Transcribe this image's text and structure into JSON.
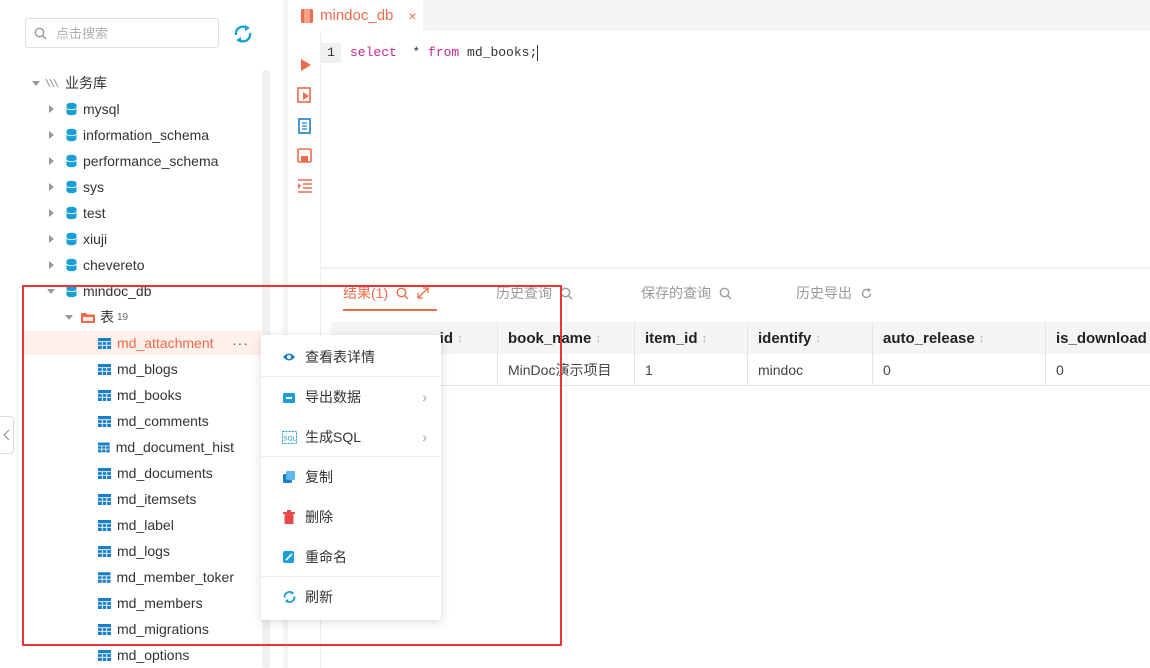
{
  "sidebar": {
    "search_placeholder": "点击搜索",
    "root": "业务库",
    "databases": [
      "mysql",
      "information_schema",
      "performance_schema",
      "sys",
      "test",
      "xiuji",
      "chevereto"
    ],
    "open_db": "mindoc_db",
    "tables_folder": "表",
    "tables_count": "19",
    "tables": [
      "md_attachment",
      "md_blogs",
      "md_books",
      "md_comments",
      "md_document_hist",
      "md_documents",
      "md_itemsets",
      "md_label",
      "md_logs",
      "md_member_toker",
      "md_members",
      "md_migrations",
      "md_options"
    ],
    "more_glyph": "···"
  },
  "editor": {
    "tab_title": "mindoc_db",
    "tab_close": "×",
    "line_number": "1",
    "code_kw1": "select",
    "code_mid": "  * ",
    "code_kw2": "from",
    "code_rest": " md_books;"
  },
  "results": {
    "tabs": [
      {
        "label": "结果(1)"
      },
      {
        "label": "历史查询"
      },
      {
        "label": "保存的查询"
      },
      {
        "label": "历史导出"
      }
    ],
    "columns": [
      "id",
      "book_name",
      "item_id",
      "identify",
      "auto_release",
      "is_download"
    ],
    "rows": [
      [
        "",
        "MinDoc演示项目",
        "1",
        "mindoc",
        "0",
        "0"
      ]
    ]
  },
  "context_menu": {
    "items": [
      "查看表详情",
      "导出数据",
      "生成SQL",
      "复制",
      "删除",
      "重命名",
      "刷新"
    ]
  },
  "colors": {
    "accent": "#ef6b4a",
    "db_icon": "#1a9fd8",
    "table_icon": "#1a7fc9",
    "highlight_box": "#e33333"
  }
}
